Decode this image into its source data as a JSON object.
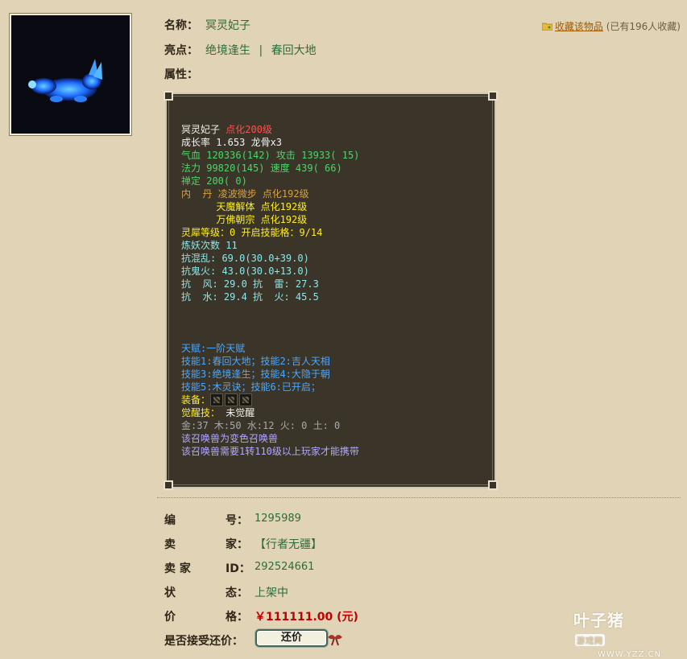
{
  "item": {
    "name_label": "名称：",
    "name": "冥灵妃子",
    "highlight_label": "亮点：",
    "highlights": [
      "绝境逢生",
      "春回大地"
    ],
    "highlight_sep": "|",
    "attr_label": "属性："
  },
  "favorite": {
    "link": "收藏该物品",
    "count_text": "(已有196人收藏)"
  },
  "panel": {
    "line1_name": "冥灵妃子",
    "line1_level": "点化200级",
    "line2": "成长率 1.653 龙骨x3",
    "line3": "气血 120336(142) 攻击 13933( 15)",
    "line4": "法力 99820(145) 速度 439( 66)",
    "line5": "禅定 200( 0)",
    "neidan_label": "内  丹",
    "neidan": [
      "凌波微步 点化192级",
      "天魔解体 点化192级",
      "万佛朝宗 点化192级"
    ],
    "lingxi": "灵犀等级：0 开启技能格：9/14",
    "lianyao": "炼妖次数 11",
    "resist": [
      "抗混乱: 69.0(30.0+39.0)",
      "抗鬼火: 43.0(30.0+13.0)",
      "抗  风: 29.0 抗  雷: 27.3",
      "抗  水: 29.4 抗  火: 45.5"
    ],
    "talent": "天赋:一阶天赋",
    "skills": [
      "技能1:春回大地；技能2:吉人天相",
      "技能3:绝境逢生；技能4:大隐于朝",
      "技能5:木灵诀；技能6:已开启；"
    ],
    "equip_label": "装备：",
    "awaken_label": "觉醒技：",
    "awaken_value": "未觉醒",
    "elements": "金:37 木:50 水:12 火: 0 土: 0",
    "note1": "该召唤兽为变色召唤兽",
    "note2": "该召唤兽需要1转110级以上玩家才能携带"
  },
  "info": {
    "id_label": [
      "编",
      "号："
    ],
    "id_value": "1295989",
    "seller_label": [
      "卖",
      "家："
    ],
    "seller_value": "【行者无疆】",
    "seller_id_label": [
      "卖  家",
      "ID："
    ],
    "seller_id_value": "292524661",
    "status_label": [
      "状",
      "态："
    ],
    "status_value": "上架中",
    "price_label": [
      "价",
      "格："
    ],
    "price_value": "￥111111.00 (元)",
    "bargain_label": "是否接受还价：",
    "bargain_button": "还价"
  },
  "watermark": {
    "brand": "叶子猪",
    "tag": "游戏网",
    "url": "WWW.YZZ.CN"
  },
  "colors": {
    "background": "#e1d4b6",
    "panel_bg": "#3a3528",
    "value_green": "#2e6b3c",
    "price_red": "#c00000"
  },
  "icons": {
    "favorite": "folder-star-icon",
    "thumbnail": "spirit-beast-icon",
    "button_deco": "ribbon-knot-icon"
  }
}
